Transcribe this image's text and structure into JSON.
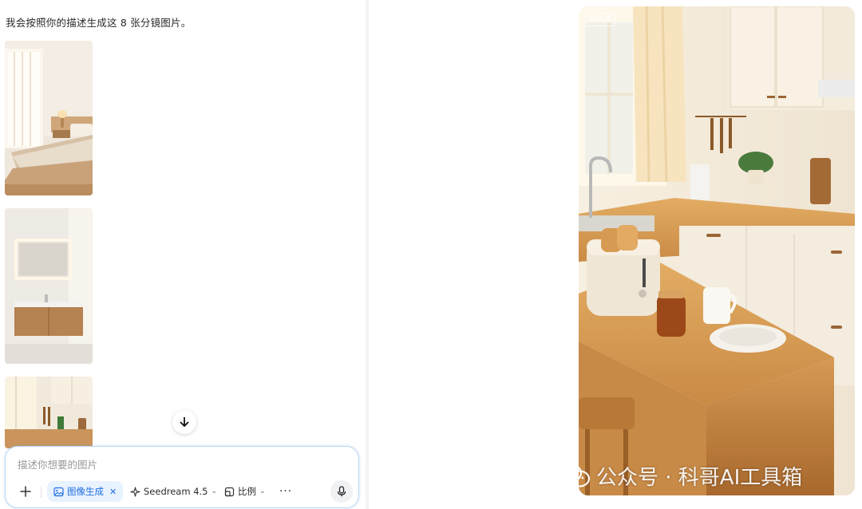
{
  "chat": {
    "message": "我会按照你的描述生成这 8 张分镜图片。"
  },
  "composer": {
    "placeholder": "描述你想要的图片",
    "active_tool_label": "图像生成",
    "model_label": "Seedream 4.5",
    "ratio_label": "比例",
    "more_label": "···"
  },
  "preview": {
    "ai_badge": "AI生成"
  },
  "watermark": {
    "text": "公众号 · 科哥AI工具箱"
  },
  "icons": {
    "scroll_down": "arrow-down-icon",
    "plus": "plus-icon",
    "image_tool": "image-icon",
    "close": "close-icon",
    "model": "sparkle-icon",
    "ratio": "aspect-ratio-icon",
    "caret": "chevron-down-icon",
    "mic": "microphone-icon",
    "wechat": "wechat-icon"
  },
  "colors": {
    "accent": "#1f6fe0",
    "chip_bg": "#e9f2ff",
    "composer_border": "#b9d7f5"
  }
}
